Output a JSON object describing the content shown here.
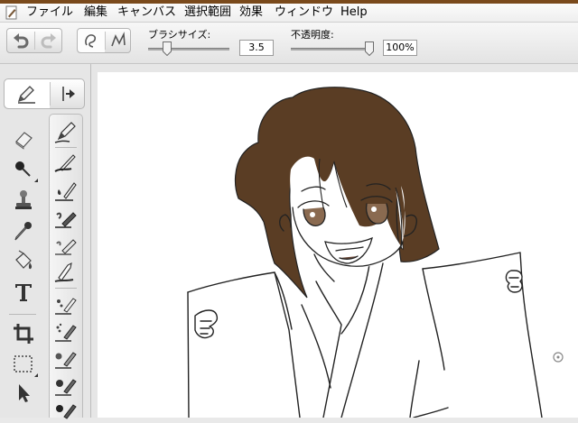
{
  "menubar": {
    "items": [
      "ファイル",
      "編集",
      "キャンバス",
      "選択範囲",
      "効果",
      "ウィンドウ",
      "Help"
    ]
  },
  "options": {
    "brush_size_label": "ブラシサイズ:",
    "brush_size_value": "3.5",
    "opacity_label": "不透明度:",
    "opacity_value": "100%"
  },
  "colors": {
    "hair": "#5a3d24",
    "accent_strip": "#7a4a1c"
  },
  "icons": {
    "history": [
      "undo-icon",
      "redo-icon"
    ],
    "stroke_modes": [
      "freehand-stroke-icon",
      "polyline-stroke-icon"
    ],
    "tabs": [
      "pen-tab-icon",
      "expand-panel-icon"
    ],
    "tools": [
      "eraser-icon",
      "color-picker-icon",
      "stamp-icon",
      "dropper-icon",
      "fill-bucket-icon",
      "text-icon",
      "crop-icon",
      "rectangle-select-icon",
      "move-icon"
    ],
    "brushes": [
      "pen-brush-icon",
      "fine-pen-brush-icon",
      "ink-brush-icon",
      "marker-brush-icon",
      "pencil-brush-icon",
      "smudge-brush-icon",
      "flat-brush-icon",
      "spray-brush-icon",
      "airbrush-icon",
      "watercolor-brush-icon",
      "texture-brush-icon"
    ],
    "canvas_handle": "rotation-handle-icon"
  }
}
